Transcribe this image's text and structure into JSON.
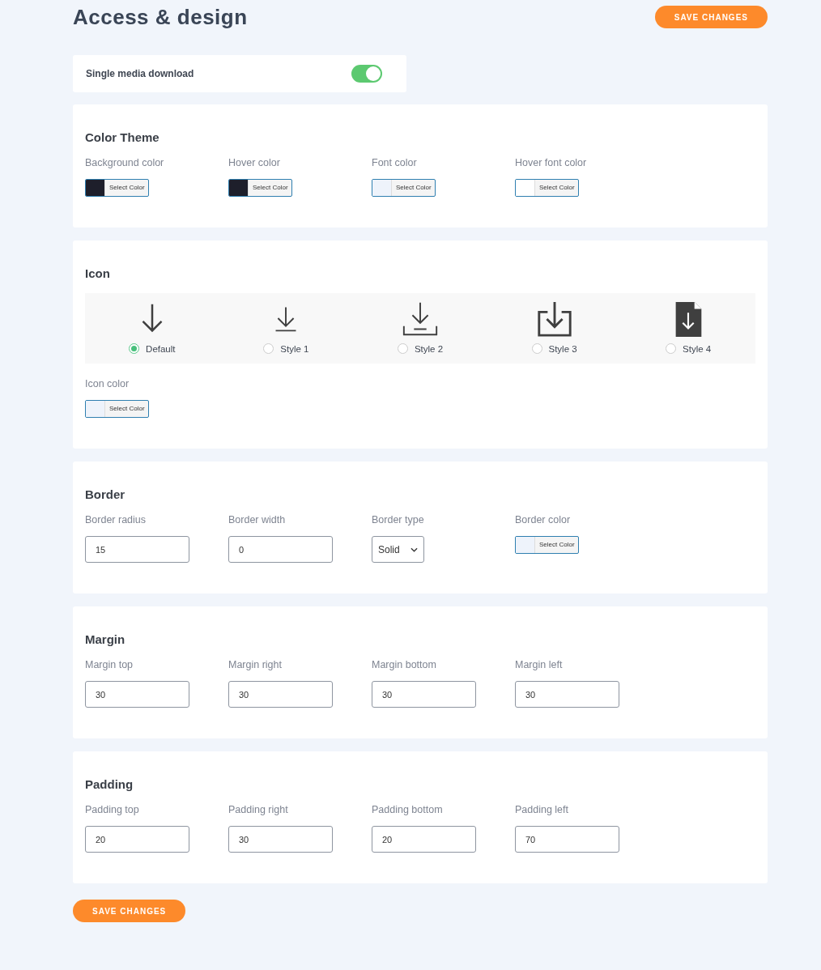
{
  "page": {
    "title": "Access & design",
    "save_label": "SAVE CHANGES"
  },
  "single_download": {
    "label": "Single media download",
    "on": true
  },
  "sections": [
    {
      "title": "Color Theme",
      "fields": [
        {
          "kind": "color",
          "label": "Background color",
          "button": "Select Color",
          "color": "#1e1f2b"
        },
        {
          "kind": "color",
          "label": "Hover color",
          "button": "Select Color",
          "color": "#1e1f2b"
        },
        {
          "kind": "color",
          "label": "Font color",
          "button": "Select Color",
          "color": "#eef3fb"
        },
        {
          "kind": "color",
          "label": "Hover font color",
          "button": "Select Color",
          "color": "#ffffff"
        }
      ]
    },
    {
      "title": "Icon",
      "icon_options": [
        {
          "label": "Default",
          "selected": true
        },
        {
          "label": "Style 1",
          "selected": false
        },
        {
          "label": "Style 2",
          "selected": false
        },
        {
          "label": "Style 3",
          "selected": false
        },
        {
          "label": "Style 4",
          "selected": false
        }
      ],
      "fields": [
        {
          "kind": "color",
          "label": "Icon color",
          "button": "Select Color",
          "color": "#eef3fb"
        }
      ]
    },
    {
      "title": "Border",
      "fields": [
        {
          "kind": "number",
          "label": "Border radius",
          "value": "15"
        },
        {
          "kind": "number",
          "label": "Border width",
          "value": "0"
        },
        {
          "kind": "select",
          "label": "Border type",
          "value": "Solid"
        },
        {
          "kind": "color",
          "label": "Border color",
          "button": "Select Color",
          "color": "#eef3fb"
        }
      ]
    },
    {
      "title": "Margin",
      "fields": [
        {
          "kind": "number",
          "label": "Margin top",
          "value": "30"
        },
        {
          "kind": "number",
          "label": "Margin right",
          "value": "30"
        },
        {
          "kind": "number",
          "label": "Margin bottom",
          "value": "30"
        },
        {
          "kind": "number",
          "label": "Margin left",
          "value": "30"
        }
      ]
    },
    {
      "title": "Padding",
      "fields": [
        {
          "kind": "number",
          "label": "Padding top",
          "value": "20"
        },
        {
          "kind": "number",
          "label": "Padding right",
          "value": "30"
        },
        {
          "kind": "number",
          "label": "Padding bottom",
          "value": "20"
        },
        {
          "kind": "number",
          "label": "Padding left",
          "value": "70"
        }
      ]
    }
  ],
  "footer": {
    "save_label": "SAVE CHANGES"
  }
}
